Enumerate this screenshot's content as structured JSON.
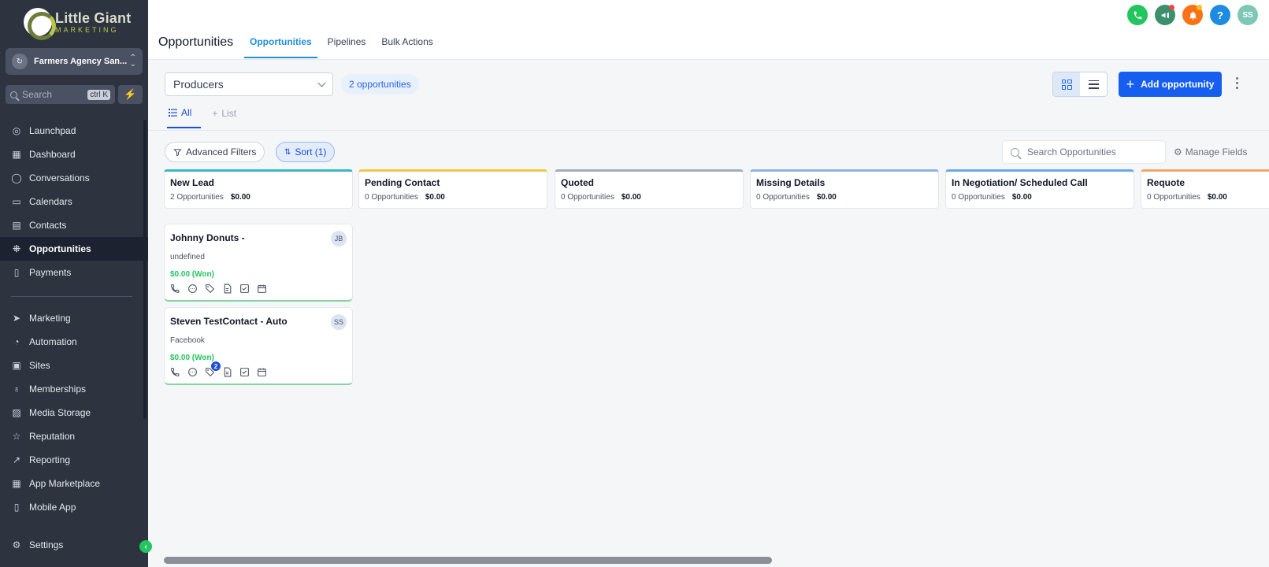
{
  "brand": {
    "line1": "Little Giant",
    "line2": "MARKETING"
  },
  "agency": {
    "name": "Farmers Agency San..."
  },
  "sidebar_search": {
    "placeholder": "Search",
    "shortcut": "ctrl K"
  },
  "nav_primary": [
    {
      "label": "Launchpad",
      "icon": "rocket-icon",
      "active": false
    },
    {
      "label": "Dashboard",
      "icon": "dashboard-icon",
      "active": false
    },
    {
      "label": "Conversations",
      "icon": "chat-icon",
      "active": false
    },
    {
      "label": "Calendars",
      "icon": "calendar-icon",
      "active": false
    },
    {
      "label": "Contacts",
      "icon": "contacts-icon",
      "active": false
    },
    {
      "label": "Opportunities",
      "icon": "opportunities-icon",
      "active": true
    },
    {
      "label": "Payments",
      "icon": "payments-icon",
      "active": false
    }
  ],
  "nav_secondary": [
    {
      "label": "Marketing",
      "icon": "send-icon"
    },
    {
      "label": "Automation",
      "icon": "automation-icon"
    },
    {
      "label": "Sites",
      "icon": "sites-icon"
    },
    {
      "label": "Memberships",
      "icon": "membership-icon"
    },
    {
      "label": "Media Storage",
      "icon": "image-icon"
    },
    {
      "label": "Reputation",
      "icon": "star-icon"
    },
    {
      "label": "Reporting",
      "icon": "chart-icon"
    },
    {
      "label": "App Marketplace",
      "icon": "apps-icon"
    },
    {
      "label": "Mobile App",
      "icon": "mobile-icon"
    }
  ],
  "settings": {
    "label": "Settings"
  },
  "header": {
    "title": "Opportunities",
    "tabs": [
      {
        "label": "Opportunities",
        "active": true
      },
      {
        "label": "Pipelines",
        "active": false
      },
      {
        "label": "Bulk Actions",
        "active": false
      }
    ],
    "avatar_initials": "SS",
    "help_glyph": "?"
  },
  "toolbar": {
    "pipeline": "Producers",
    "count_label": "2 opportunities",
    "add_label": "Add opportunity"
  },
  "subtabs": {
    "all": "All",
    "list": "List"
  },
  "filters": {
    "advanced": "Advanced Filters",
    "sort": "Sort (1)",
    "search_placeholder": "Search Opportunities",
    "manage_fields": "Manage Fields"
  },
  "columns": [
    {
      "title": "New Lead",
      "count": "2 Opportunities",
      "value": "$0.00",
      "color": "#3fb6c4"
    },
    {
      "title": "Pending Contact",
      "count": "0 Opportunities",
      "value": "$0.00",
      "color": "#f1c64a"
    },
    {
      "title": "Quoted",
      "count": "0 Opportunities",
      "value": "$0.00",
      "color": "#a3acbd"
    },
    {
      "title": "Missing Details",
      "count": "0 Opportunities",
      "value": "$0.00",
      "color": "#8fb3e0"
    },
    {
      "title": "In Negotiation/ Scheduled Call",
      "count": "0 Opportunities",
      "value": "$0.00",
      "color": "#6aa9e9"
    },
    {
      "title": "Requote",
      "count": "0 Opportunities",
      "value": "$0.00",
      "color": "#f0a66b"
    }
  ],
  "cards": [
    {
      "title": "Johnny Donuts -",
      "source": "undefined",
      "value": "$0.00 (Won)",
      "initials": "JB",
      "tag_badge": ""
    },
    {
      "title": "Steven TestContact - Auto",
      "source": "Facebook",
      "value": "$0.00 (Won)",
      "initials": "SS",
      "tag_badge": "2"
    }
  ]
}
